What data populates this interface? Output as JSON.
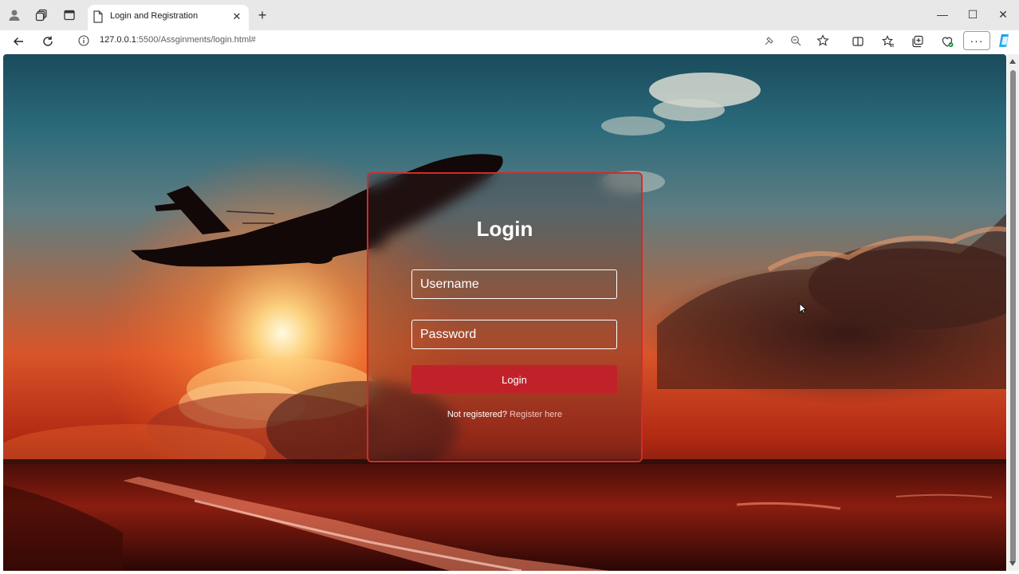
{
  "browser": {
    "tab": {
      "title": "Login and Registration",
      "close_glyph": "✕"
    },
    "new_tab_glyph": "+",
    "window_controls": {
      "minimize": "—",
      "maximize": "☐",
      "close": "✕"
    },
    "address": {
      "host": "127.0.0.1",
      "path": ":5500/Assginments/login.html#"
    },
    "more_glyph": "···",
    "icons": [
      "profile-icon",
      "workspaces-icon",
      "tab-actions-icon",
      "back-icon",
      "refresh-icon",
      "info-icon",
      "read-aloud-icon",
      "zoom-icon",
      "favorite-star-icon",
      "split-screen-icon",
      "favorites-icon",
      "collections-icon",
      "browser-essentials-icon",
      "copilot-icon"
    ]
  },
  "login": {
    "title": "Login",
    "username_placeholder": "Username",
    "password_placeholder": "Password",
    "button_label": "Login",
    "register_prompt": "Not registered?",
    "register_link": "Register here"
  },
  "colors": {
    "card_border": "#d42a2a",
    "button": "#c1222a",
    "link": "#f3c3c3"
  }
}
